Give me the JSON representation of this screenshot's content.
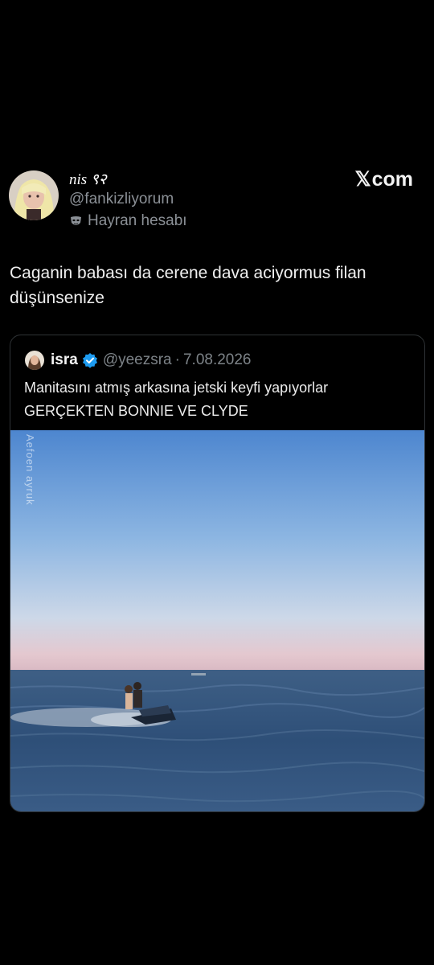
{
  "post": {
    "author_name": "nis ९२",
    "author_handle": "@fankizliyorum",
    "fan_label": "Hayran hesabı",
    "fan_icon": "mask-icon",
    "site_brand": "com",
    "text": "Caganin babası da cerene dava aciyormus filan düşünsenize"
  },
  "quote": {
    "author_name": "isra",
    "verified_icon": "verified-badge-icon",
    "author_handle": "@yeezsra",
    "separator": "·",
    "date": "7.08.2026",
    "text_line1": "Manitasını atmış arkasına jetski keyfi yapıyorlar",
    "text_line2": "GERÇEKTEN BONNIE VE CLYDE",
    "media_watermark": "Aefoen ayruk"
  },
  "colors": {
    "background": "#000000",
    "verified": "#1d9bf0",
    "muted_text": "#8b9096"
  }
}
